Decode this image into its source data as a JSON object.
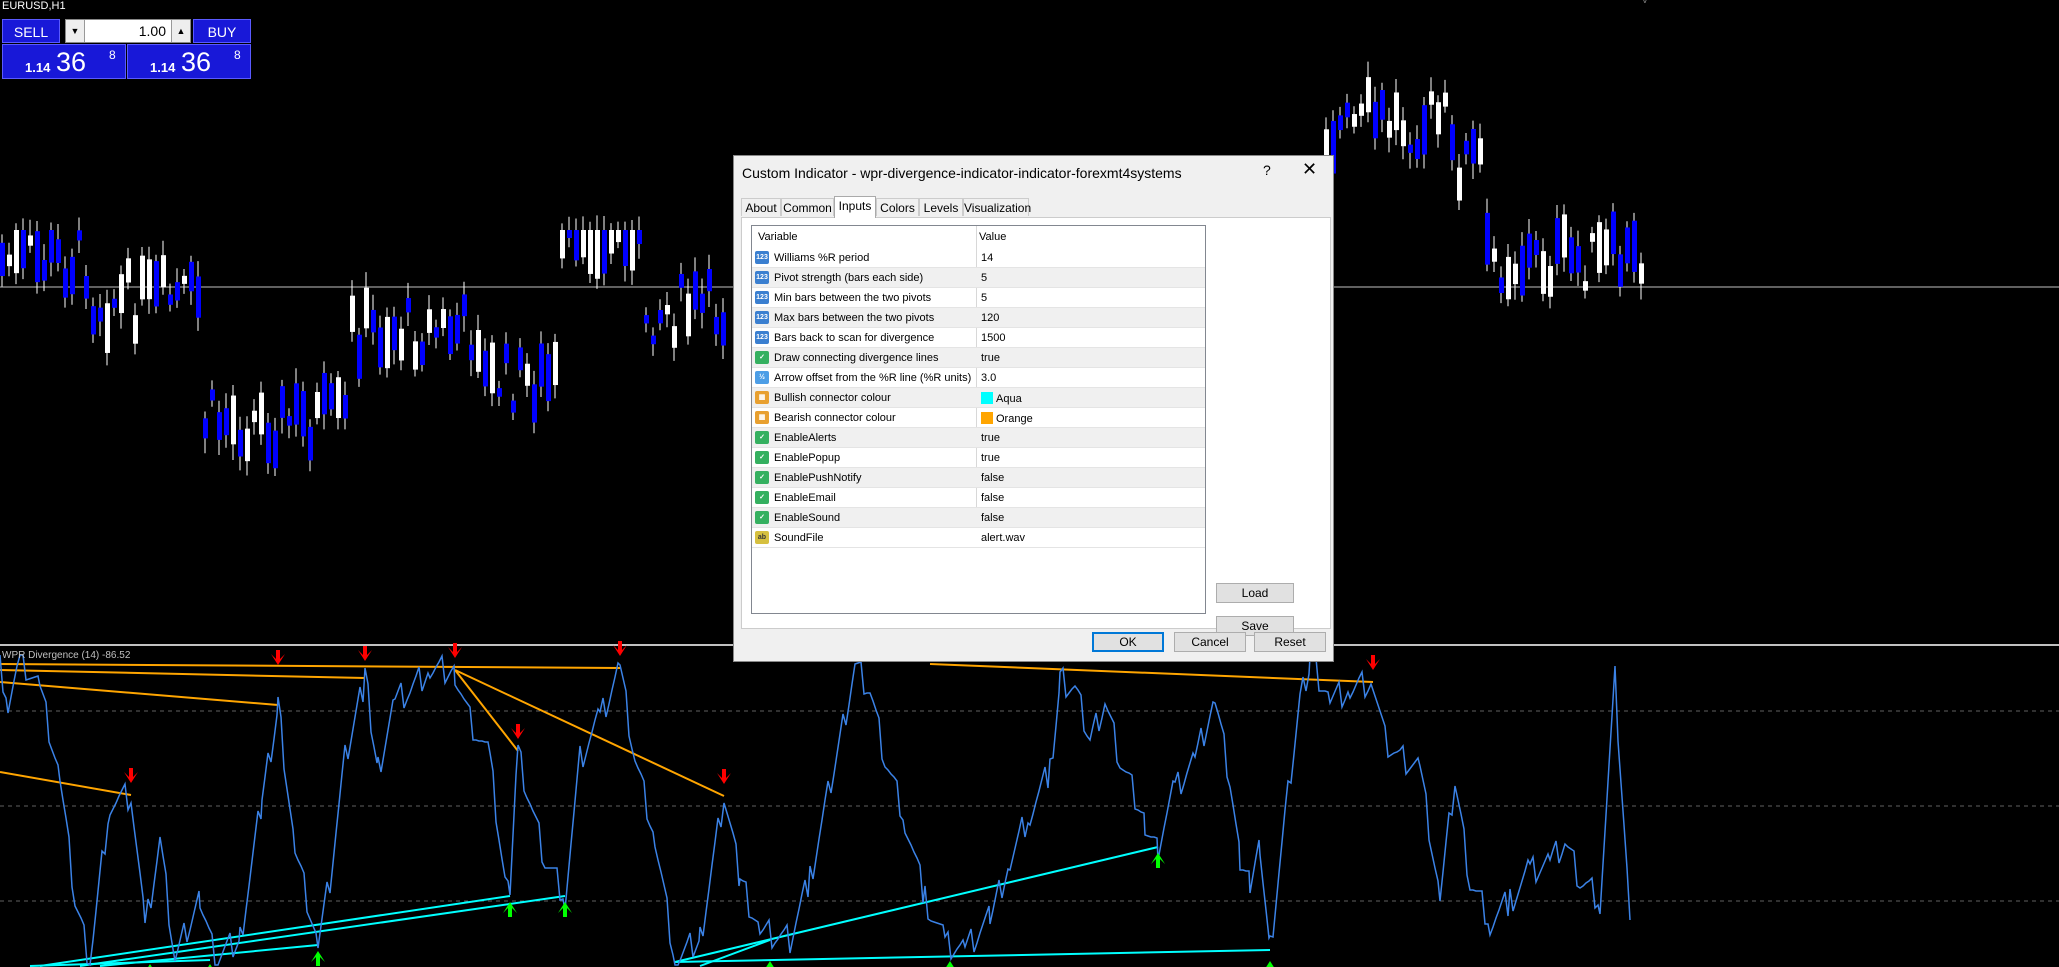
{
  "window": {
    "symbol": "EURUSD,H1"
  },
  "trade_panel": {
    "sell_label": "SELL",
    "buy_label": "BUY",
    "lot_value": "1.00",
    "sell_price": {
      "big": "1.14",
      "pips": "36",
      "frac": "8"
    },
    "buy_price": {
      "big": "1.14",
      "pips": "36",
      "frac": "8"
    }
  },
  "indicator": {
    "label": "WPR Divergence (14) -86.52"
  },
  "colors": {
    "bull_candle": "#ffffff",
    "bear_candle": "#0000ff",
    "wpr_line": "#3b82e6",
    "bullish_connector": "#00ffff",
    "bearish_connector": "#ffa500",
    "bull_arrow": "#00ff00",
    "bear_arrow": "#ff0000"
  },
  "icons": {
    "variable_types": [
      "number-icon",
      "bool-icon",
      "double-icon",
      "color-icon",
      "string-icon"
    ],
    "arrows": [
      "up-arrow-icon",
      "down-arrow-icon"
    ]
  },
  "dialog": {
    "title": "Custom Indicator - wpr-divergence-indicator-indicator-forexmt4systems",
    "help": "?",
    "close": "✕",
    "tabs": [
      "About",
      "Common",
      "Inputs",
      "Colors",
      "Levels",
      "Visualization"
    ],
    "active_tab": "Inputs",
    "columns": {
      "variable": "Variable",
      "value": "Value"
    },
    "inputs": [
      {
        "icon": "123",
        "name": "Williams %R period",
        "value": "14"
      },
      {
        "icon": "123",
        "name": "Pivot strength (bars each side)",
        "value": "5"
      },
      {
        "icon": "123",
        "name": "Min bars between the two pivots",
        "value": "5"
      },
      {
        "icon": "123",
        "name": "Max bars between the two pivots",
        "value": "120"
      },
      {
        "icon": "123",
        "name": "Bars back to scan for divergence",
        "value": "1500"
      },
      {
        "icon": "bool",
        "name": "Draw connecting divergence lines",
        "value": "true"
      },
      {
        "icon": "1/2",
        "name": "Arrow offset from the %R line (%R units)",
        "value": "3.0"
      },
      {
        "icon": "color",
        "name": "Bullish connector colour",
        "value": "Aqua",
        "swatch": "#00ffff"
      },
      {
        "icon": "color",
        "name": "Bearish connector colour",
        "value": "Orange",
        "swatch": "#ffa500"
      },
      {
        "icon": "bool",
        "name": "EnableAlerts",
        "value": "true"
      },
      {
        "icon": "bool",
        "name": "EnablePopup",
        "value": "true"
      },
      {
        "icon": "bool",
        "name": "EnablePushNotify",
        "value": "false"
      },
      {
        "icon": "bool",
        "name": "EnableEmail",
        "value": "false"
      },
      {
        "icon": "bool",
        "name": "EnableSound",
        "value": "false"
      },
      {
        "icon": "ab",
        "name": "SoundFile",
        "value": "alert.wav"
      }
    ],
    "load_label": "Load",
    "save_label": "Save",
    "ok_label": "OK",
    "cancel_label": "Cancel",
    "reset_label": "Reset"
  }
}
